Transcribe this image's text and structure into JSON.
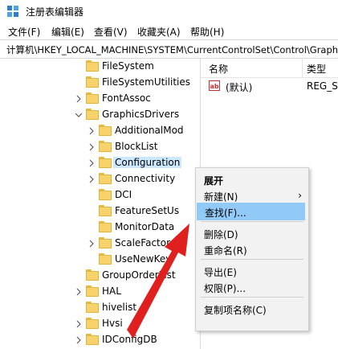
{
  "window": {
    "title": "注册表编辑器"
  },
  "menubar": {
    "items": [
      "文件(F)",
      "编辑(E)",
      "查看(V)",
      "收藏夹(A)",
      "帮助(H)"
    ]
  },
  "address": {
    "path": "计算机\\HKEY_LOCAL_MACHINE\\SYSTEM\\CurrentControlSet\\Control\\GraphicsDrivers\\Configuration"
  },
  "tree": {
    "items": [
      {
        "label": "FileSystem",
        "level": 1,
        "expander": "none"
      },
      {
        "label": "FileSystemUtilities",
        "level": 1,
        "expander": "none"
      },
      {
        "label": "FontAssoc",
        "level": 1,
        "expander": "collapsed"
      },
      {
        "label": "GraphicsDrivers",
        "level": 1,
        "expander": "expanded"
      },
      {
        "label": "AdditionalMod",
        "level": 2,
        "expander": "collapsed"
      },
      {
        "label": "BlockList",
        "level": 2,
        "expander": "collapsed"
      },
      {
        "label": "Configuration",
        "level": 2,
        "expander": "collapsed",
        "selected": true
      },
      {
        "label": "Connectivity",
        "level": 2,
        "expander": "collapsed"
      },
      {
        "label": "DCI",
        "level": 2,
        "expander": "none"
      },
      {
        "label": "FeatureSetUs",
        "level": 2,
        "expander": "none"
      },
      {
        "label": "MonitorData",
        "level": 2,
        "expander": "none"
      },
      {
        "label": "ScaleFactor",
        "level": 2,
        "expander": "collapsed"
      },
      {
        "label": "UseNewKey",
        "level": 2,
        "expander": "none"
      },
      {
        "label": "GroupOrderList",
        "level": 1,
        "expander": "none"
      },
      {
        "label": "HAL",
        "level": 1,
        "expander": "collapsed"
      },
      {
        "label": "hivelist",
        "level": 1,
        "expander": "none"
      },
      {
        "label": "Hvsi",
        "level": 1,
        "expander": "collapsed"
      },
      {
        "label": "IDConfigDB",
        "level": 1,
        "expander": "collapsed"
      }
    ]
  },
  "list": {
    "headers": {
      "name": "名称",
      "type": "类型"
    },
    "rows": [
      {
        "name": "(默认)",
        "type": "REG_SZ",
        "icon": "ab-string-icon"
      }
    ]
  },
  "context_menu": {
    "items": [
      {
        "label": "展开",
        "bold": true
      },
      {
        "label": "新建(N)",
        "submenu": true
      },
      {
        "label": "查找(F)...",
        "highlighted": true
      },
      {
        "separator": true
      },
      {
        "label": "删除(D)"
      },
      {
        "label": "重命名(R)"
      },
      {
        "separator": true
      },
      {
        "label": "导出(E)"
      },
      {
        "label": "权限(P)..."
      },
      {
        "separator": true
      },
      {
        "label": "复制项名称(C)"
      }
    ]
  },
  "colors": {
    "selection": "#cce8ff",
    "menu_highlight": "#91c9f7",
    "folder": "#f8d26a",
    "arrow": "#e0201f"
  }
}
